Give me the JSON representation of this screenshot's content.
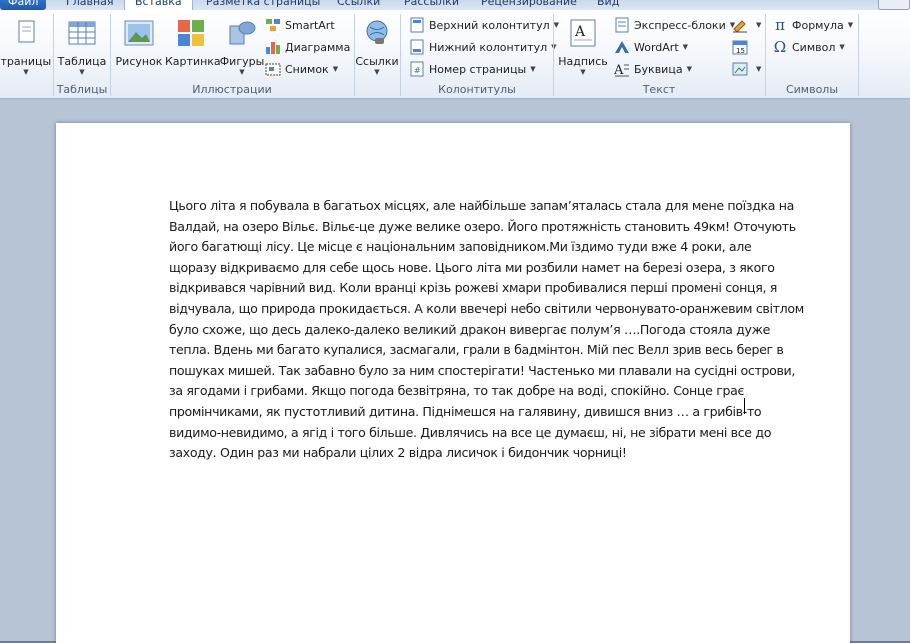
{
  "tabs": [
    {
      "label": "Файл",
      "kind": "file"
    },
    {
      "label": "Главная",
      "kind": "normal"
    },
    {
      "label": "Вставка",
      "kind": "active"
    },
    {
      "label": "Разметка страницы",
      "kind": "normal"
    },
    {
      "label": "Ссылки",
      "kind": "normal"
    },
    {
      "label": "Рассылки",
      "kind": "normal"
    },
    {
      "label": "Рецензирование",
      "kind": "normal"
    },
    {
      "label": "Вид",
      "kind": "normal"
    }
  ],
  "ribbon": {
    "pages": {
      "label": "Страницы"
    },
    "tables": {
      "group": "Таблицы",
      "table": "Таблица"
    },
    "illustrations": {
      "group": "Иллюстрации",
      "picture": "Рисунок",
      "clipart": "Картинка",
      "shapes": "Фигуры",
      "smartart": "SmartArt",
      "chart": "Диаграмма",
      "screenshot": "Снимок"
    },
    "links": {
      "label": "Ссылки"
    },
    "headers": {
      "group": "Колонтитулы",
      "header": "Верхний колонтитул",
      "footer": "Нижний колонтитул",
      "page_number": "Номер страницы"
    },
    "text": {
      "group": "Текст",
      "textbox": "Надпись",
      "quickparts": "Экспресс-блоки",
      "wordart": "WordArt",
      "dropcap": "Буквица"
    },
    "symbols": {
      "group": "Символы",
      "equation": "Формула",
      "symbol": "Символ"
    }
  },
  "document": {
    "lines": [
      "Цього літа я побувала в багатьох місцях, але найбільше запам’яталась стала для мене поїздка на",
      "Валдай, на озеро Вільє. Вільє-це дуже велике озеро. Його протяжність становить 49км! Оточують",
      "його багатющі лісу. Це місце є національним заповідником.Ми їздимо туди вже 4 роки, але",
      "щоразу відкриваємо для себе щось нове. Цього літа ми розбили намет на березі озера, з якого",
      "відкривався чарівний вид. Коли вранці крізь рожеві хмари пробивалися перші промені сонця, я",
      "відчувала, що природа прокидається. А коли ввечері небо світили червонувато-оранжевим світлом",
      "було схоже, що десь далеко-далеко великий дракон вивергає полум’я ….Погода стояла дуже",
      "тепла. Вдень ми багато купалися, засмагали, грали в бадмінтон. Мій пес Велл зрив весь берег в",
      "пошуках мишей. Так забавно було за ним спостерігати! Частенько ми плавали на сусідні острови,",
      "за ягодами і грибами. Якщо погода безвітряна, то так добре на воді, спокійно. Сонце грає",
      "промінчиками, як пустотливий дитина. Піднімешся на галявину, дивишся вниз … а грибів-то",
      "видимо-невидимо, а ягід і того більше. Дивлячись на все це думаєш, ні, не зібрати мені все до",
      "заходу. Один раз ми набрали цілих 2 відра лисичок і бидончик чорниці!"
    ]
  },
  "colors": {
    "accent": "#1e5aa8",
    "tab_text": "#1e395b",
    "group_label": "#4f5f75",
    "page_bg": "#b7c4d5"
  }
}
